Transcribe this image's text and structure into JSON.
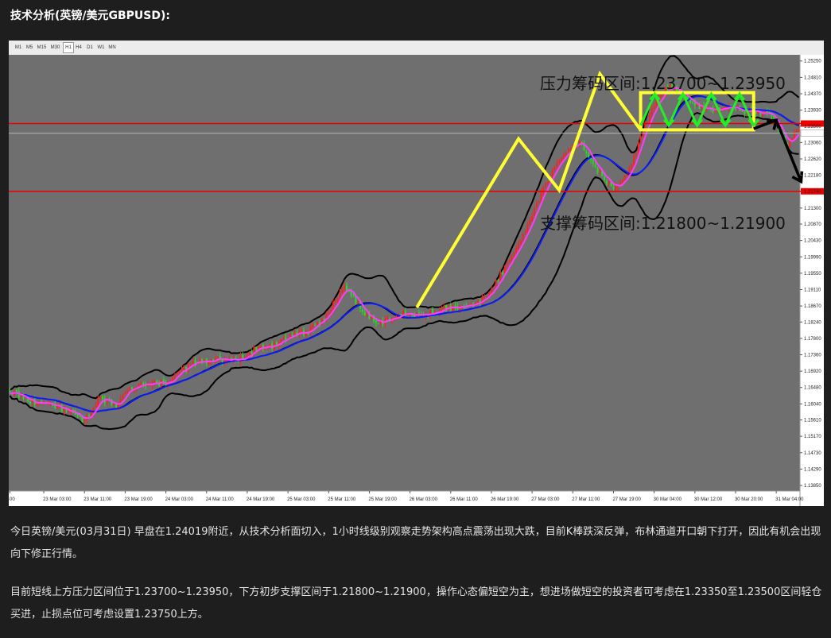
{
  "page": {
    "title": "技术分析(英镑/美元GBPUSD):",
    "paragraph1": "今日英镑/美元(03月31日) 早盘在1.24019附近，从技术分析面切入，1小时线级别观察走势架构高点震荡出现大跌，目前K棒跌深反弹，布林通道开口朝下打开，因此有机会出现向下修正行情。",
    "paragraph2": "目前短线上方压力区间位于1.23700~1.23950，下方初步支撑区间于1.21800~1.21900，操作心态偏短空为主，想进场做短空的投资者可考虑在1.23350至1.23500区间轻仓买进，止损点位可考虑设置1.23750上方。"
  },
  "toolbar": {
    "timeframes": [
      "M1",
      "M5",
      "M15",
      "M30",
      "H1",
      "H4",
      "D1",
      "W1",
      "MN"
    ],
    "active": "H1"
  },
  "colors": {
    "page_bg": "#1e1e1e",
    "plot_bg": "#6f6f6f",
    "bull": "#ff1f1f",
    "bear": "#22dd22",
    "ma_fast": "#ff3cff",
    "ma_slow": "#0a1cff",
    "bollinger": "#000000",
    "hline": "#ee0000",
    "zigzag": "#ffff33",
    "box": "#ffff33",
    "zigzag2": "#22ee22",
    "arrow": "#000000"
  },
  "chart_data": {
    "type": "candlestick",
    "symbol": "GBPUSD",
    "timeframe": "H1",
    "ylim": [
      1.1385,
      1.2533
    ],
    "y_ticks": [
      "1.25250",
      "1.24810",
      "1.24370",
      "1.23930",
      "1.23500",
      "1.23060",
      "1.22620",
      "1.22180",
      "1.21740",
      "1.21300",
      "1.20870",
      "1.20430",
      "1.19990",
      "1.19550",
      "1.19110",
      "1.18670",
      "1.18240",
      "1.17800",
      "1.17360",
      "1.16920",
      "1.16480",
      "1.16040",
      "1.15610",
      "1.15170",
      "1.14730",
      "1.14290",
      "1.13850"
    ],
    "x_ticks": [
      "00",
      "23 Mar 03:00",
      "23 Mar 11:00",
      "23 Mar 19:00",
      "24 Mar 03:00",
      "24 Mar 11:00",
      "24 Mar 19:00",
      "25 Mar 03:00",
      "25 Mar 11:00",
      "25 Mar 19:00",
      "26 Mar 03:00",
      "26 Mar 11:00",
      "26 Mar 19:00",
      "27 Mar 03:00",
      "27 Mar 11:00",
      "27 Mar 19:00",
      "30 Mar 04:00",
      "30 Mar 12:00",
      "30 Mar 20:00",
      "31 Mar 04:00"
    ],
    "price_marks": {
      "resistance_line": 1.2357,
      "support_line": 1.2175,
      "current": 1.2331
    },
    "annotations": {
      "resistance": "压力筹码区间:1.23700~1.23950",
      "support": "支撑筹码区间:1.21800~1.21900"
    },
    "zones": {
      "resistance": [
        1.234,
        1.244
      ]
    },
    "zigzag_up": [
      [
        "26 Mar 05:00",
        1.1863
      ],
      [
        "27 Mar 00:00",
        1.2316
      ],
      [
        "27 Mar 08:00",
        1.2178
      ],
      [
        "27 Mar 14:00",
        1.249
      ],
      [
        "27 Mar 22:00",
        1.234
      ]
    ],
    "trend_down": [
      [
        "31 Mar 00:00",
        1.2343
      ],
      [
        "31 Mar 05:00",
        1.2366
      ],
      [
        "31 Mar 11:00",
        1.2201
      ]
    ],
    "grid": false,
    "anchor_closes": [
      [
        0,
        1.164
      ],
      [
        9,
        1.161
      ],
      [
        17,
        1.161
      ],
      [
        26,
        1.158
      ],
      [
        33,
        1.156
      ],
      [
        40,
        1.162
      ],
      [
        47,
        1.16
      ],
      [
        54,
        1.165
      ],
      [
        62,
        1.166
      ],
      [
        70,
        1.166
      ],
      [
        80,
        1.171
      ],
      [
        90,
        1.1725
      ],
      [
        100,
        1.172
      ],
      [
        108,
        1.175
      ],
      [
        116,
        1.176
      ],
      [
        124,
        1.179
      ],
      [
        132,
        1.18
      ],
      [
        138,
        1.183
      ],
      [
        144,
        1.188
      ],
      [
        148,
        1.192
      ],
      [
        153,
        1.188
      ],
      [
        158,
        1.184
      ],
      [
        163,
        1.182
      ],
      [
        168,
        1.183
      ],
      [
        174,
        1.185
      ],
      [
        180,
        1.184
      ],
      [
        186,
        1.185
      ],
      [
        192,
        1.186
      ],
      [
        198,
        1.1865
      ],
      [
        202,
        1.1862
      ],
      [
        206,
        1.187
      ],
      [
        212,
        1.19
      ],
      [
        218,
        1.196
      ],
      [
        224,
        1.202
      ],
      [
        230,
        1.21
      ],
      [
        236,
        1.218
      ],
      [
        242,
        1.225
      ],
      [
        248,
        1.229
      ],
      [
        252,
        1.231
      ],
      [
        256,
        1.227
      ],
      [
        260,
        1.223
      ],
      [
        264,
        1.22
      ],
      [
        268,
        1.2185
      ],
      [
        272,
        1.221
      ],
      [
        276,
        1.226
      ],
      [
        280,
        1.234
      ],
      [
        286,
        1.242
      ],
      [
        292,
        1.246
      ],
      [
        296,
        1.244
      ],
      [
        300,
        1.242
      ],
      [
        306,
        1.24
      ],
      [
        312,
        1.239
      ],
      [
        318,
        1.24
      ],
      [
        324,
        1.239
      ],
      [
        330,
        1.239
      ],
      [
        336,
        1.238
      ],
      [
        340,
        1.234
      ],
      [
        344,
        1.23
      ],
      [
        348,
        1.234
      ]
    ],
    "total_bars": 350,
    "ma_periods": [
      5,
      21
    ],
    "bollinger": {
      "period": 20,
      "deviation": 2.2
    }
  }
}
